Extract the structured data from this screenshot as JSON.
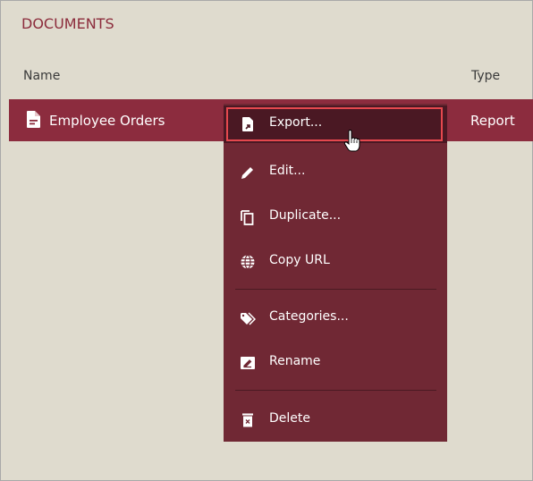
{
  "panel": {
    "title": "DOCUMENTS"
  },
  "table": {
    "columns": [
      "Name",
      "Type"
    ],
    "rows": [
      {
        "name": "Employee Orders",
        "type": "Report",
        "icon": "document-icon",
        "selected": true
      }
    ]
  },
  "context_menu": {
    "items": [
      {
        "label": "Export...",
        "icon": "export-file-icon",
        "active": true
      },
      {
        "label": "Edit...",
        "icon": "pencil-icon"
      },
      {
        "label": "Duplicate...",
        "icon": "copy-icon"
      },
      {
        "label": "Copy URL",
        "icon": "globe-icon"
      },
      {
        "label": "Categories...",
        "icon": "tags-icon"
      },
      {
        "label": "Rename",
        "icon": "rename-icon"
      },
      {
        "label": "Delete",
        "icon": "trash-icon"
      }
    ]
  },
  "colors": {
    "accent": "#8c2c3e",
    "menu_bg": "#702834",
    "active_bg": "#4a1823",
    "focus_border": "#e5484e",
    "background": "#dfdbce"
  }
}
